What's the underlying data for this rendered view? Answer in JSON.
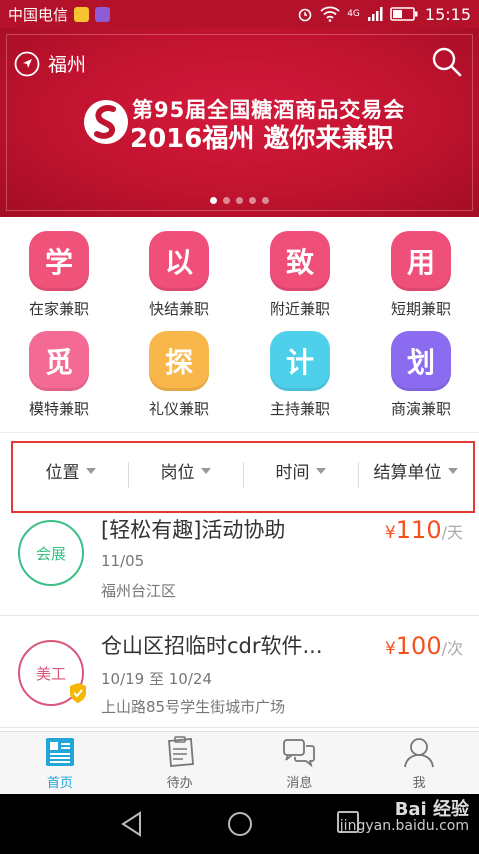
{
  "status_bar": {
    "carrier": "中国电信",
    "network": "4G",
    "time": "15:15"
  },
  "header": {
    "city": "福州",
    "search_icon": "search-icon"
  },
  "banner": {
    "line1": "第95届全国糖酒商品交易会",
    "line2": "2016福州 邀你来兼职",
    "slide_count": 5,
    "active_slide": 0
  },
  "categories": [
    {
      "char": "学",
      "label": "在家兼职",
      "color": "#f0537a"
    },
    {
      "char": "以",
      "label": "快结兼职",
      "color": "#ef4f79"
    },
    {
      "char": "致",
      "label": "附近兼职",
      "color": "#ee4e78"
    },
    {
      "char": "用",
      "label": "短期兼职",
      "color": "#ef507a"
    },
    {
      "char": "觅",
      "label": "模特兼职",
      "color": "#f36b95"
    },
    {
      "char": "探",
      "label": "礼仪兼职",
      "color": "#f9b64a"
    },
    {
      "char": "计",
      "label": "主持兼职",
      "color": "#4fd0ea"
    },
    {
      "char": "划",
      "label": "商演兼职",
      "color": "#8b6cf0"
    }
  ],
  "filters": [
    "位置",
    "岗位",
    "时间",
    "结算单位"
  ],
  "jobs": [
    {
      "badge": "会展",
      "badge_color": "#3cbf86",
      "verified": false,
      "title": "[轻松有趣]活动协助",
      "date": "11/05",
      "address": "福州台江区",
      "currency": "¥",
      "amount": "110",
      "unit": "/天"
    },
    {
      "badge": "美工",
      "badge_color": "#d9577a",
      "verified": true,
      "title": "仓山区招临时cdr软件...",
      "date": "10/19 至 10/24",
      "address": "上山路85号学生街城市广场",
      "currency": "¥",
      "amount": "100",
      "unit": "/次"
    }
  ],
  "tabs": [
    {
      "label": "首页",
      "icon": "home-list-icon",
      "active": true
    },
    {
      "label": "待办",
      "icon": "clipboard-icon",
      "active": false
    },
    {
      "label": "消息",
      "icon": "chat-bubbles-icon",
      "active": false
    },
    {
      "label": "我",
      "icon": "person-icon",
      "active": false
    }
  ],
  "watermark": {
    "brand": "Bai 经验",
    "url": "jingyan.baidu.com"
  }
}
